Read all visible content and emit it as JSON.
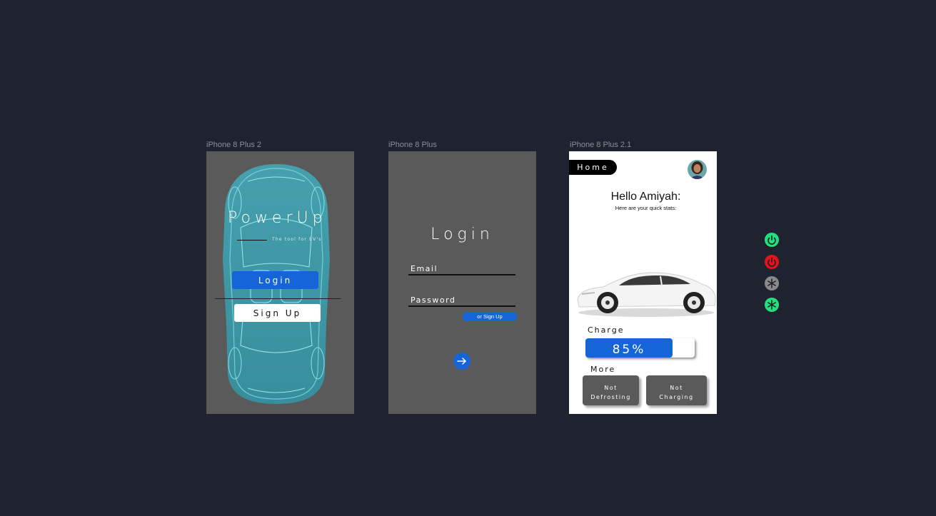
{
  "artboards": [
    {
      "label": "iPhone 8 Plus 2"
    },
    {
      "label": "iPhone 8 Plus"
    },
    {
      "label": "iPhone 8 Plus 2.1"
    }
  ],
  "splash": {
    "brand": "PowerUp",
    "tagline": "The tool for EV's",
    "login_label": "Login",
    "signup_label": "Sign Up"
  },
  "login": {
    "title": "Login",
    "email_label": "Email",
    "password_label": "Password",
    "signup_link": "or Sign Up"
  },
  "home": {
    "nav_label": "Home",
    "greeting": "Hello Amiyah:",
    "subtitle": "Here are your quick stats:",
    "charge_label": "Charge",
    "charge_value": "85%",
    "charge_level": 0.85,
    "more_label": "More",
    "defrost_label_1": "Not",
    "defrost_label_2": "Defrosting",
    "charging_label_1": "Not",
    "charging_label_2": "Charging"
  },
  "icons": [
    "power-on-icon",
    "power-off-icon",
    "defrost-off-icon",
    "defrost-on-icon"
  ],
  "colors": {
    "accent": "#1565d8",
    "green": "#22e07a",
    "red": "#e4131b",
    "grey": "#8a8a8a"
  }
}
